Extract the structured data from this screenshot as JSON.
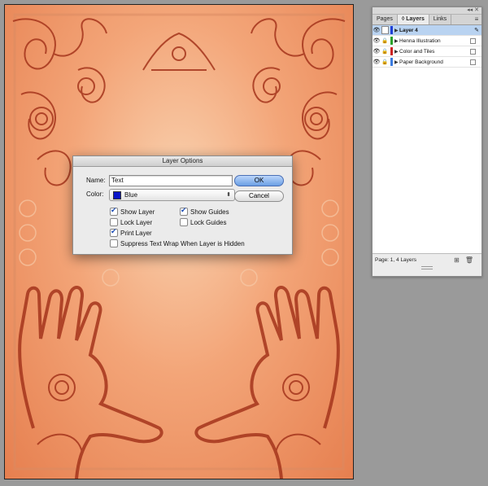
{
  "artboard": {
    "background_colors": [
      "#f9d2b0",
      "#f3a578",
      "#e67f4f"
    ],
    "motif_color": "#a5351c"
  },
  "layers_panel": {
    "tabs": [
      {
        "label": "Pages",
        "active": false
      },
      {
        "label": "◊ Layers",
        "active": true
      },
      {
        "label": "Links",
        "active": false
      }
    ],
    "menu_icon": "panel-menu-icon",
    "layers": [
      {
        "name": "Layer 4",
        "color": "#1f3fd6",
        "visible": true,
        "locked": false,
        "selected": true
      },
      {
        "name": "Henna Illustration",
        "color": "#2aa12a",
        "visible": true,
        "locked": true,
        "selected": false
      },
      {
        "name": "Color and Tiles",
        "color": "#cc2121",
        "visible": true,
        "locked": true,
        "selected": false
      },
      {
        "name": "Paper Background",
        "color": "#3a7be0",
        "visible": true,
        "locked": true,
        "selected": false
      }
    ],
    "footer_text": "Page: 1, 4 Layers"
  },
  "dialog": {
    "title": "Layer Options",
    "name_label": "Name:",
    "name_value": "Text",
    "color_label": "Color:",
    "color_value": "Blue",
    "color_swatch": "#0a15c8",
    "ok_label": "OK",
    "cancel_label": "Cancel",
    "checkboxes": {
      "show_layer": {
        "label": "Show Layer",
        "checked": true
      },
      "show_guides": {
        "label": "Show Guides",
        "checked": true
      },
      "lock_layer": {
        "label": "Lock Layer",
        "checked": false
      },
      "lock_guides": {
        "label": "Lock Guides",
        "checked": false
      },
      "print_layer": {
        "label": "Print Layer",
        "checked": true
      },
      "suppress_wrap": {
        "label": "Suppress Text Wrap When Layer is Hidden",
        "checked": false
      }
    }
  }
}
